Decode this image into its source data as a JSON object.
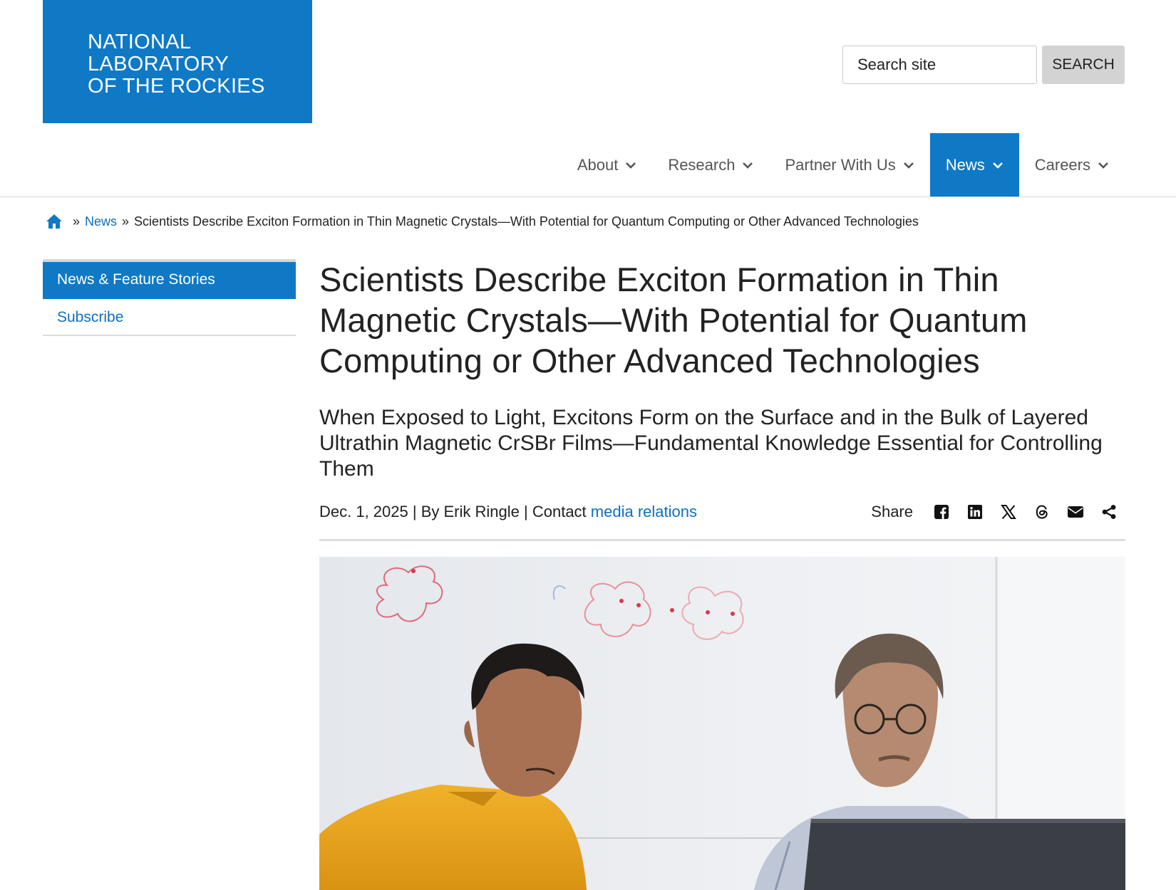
{
  "logo": {
    "lines": [
      "NATIONAL",
      "LABORATORY",
      "OF THE ROCKIES"
    ]
  },
  "search": {
    "placeholder": "Search site",
    "button_label": "SEARCH"
  },
  "nav": {
    "items": [
      {
        "label": "About"
      },
      {
        "label": "Research"
      },
      {
        "label": "Partner With Us"
      },
      {
        "label": "News",
        "active": true
      },
      {
        "label": "Careers"
      }
    ]
  },
  "breadcrumb": {
    "home_icon": "home-icon",
    "separator": "»",
    "news": "News",
    "current": "Scientists Describe Exciton Formation in Thin Magnetic Crystals—With Potential for Quantum Computing or Other Advanced Technologies"
  },
  "sidebar": {
    "items": [
      {
        "label": "News & Feature Stories",
        "active": true
      },
      {
        "label": "Subscribe"
      }
    ]
  },
  "article": {
    "title": "Scientists Describe Exciton Formation in Thin Magnetic Crystals—With Potential for Quantum Computing or Other Advanced Technologies",
    "subtitle": "When Exposed to Light, Excitons Form on the Surface and in the Bulk of Layered Ultrathin Magnetic CrSBr Films—Fundamental Knowledge Essential for Controlling Them",
    "date": "Dec. 1, 2025",
    "byline": "By Erik Ringle",
    "contact_prefix": "Contact",
    "contact_link": "media relations",
    "separator": "|"
  },
  "share": {
    "label": "Share",
    "icons": [
      "facebook-icon",
      "linkedin-icon",
      "x-icon",
      "threads-icon",
      "email-icon",
      "share-icon"
    ]
  },
  "colors": {
    "brand_blue": "#0f79c6",
    "link_blue": "#0f6fbf",
    "search_button": "#d3d3d3"
  }
}
